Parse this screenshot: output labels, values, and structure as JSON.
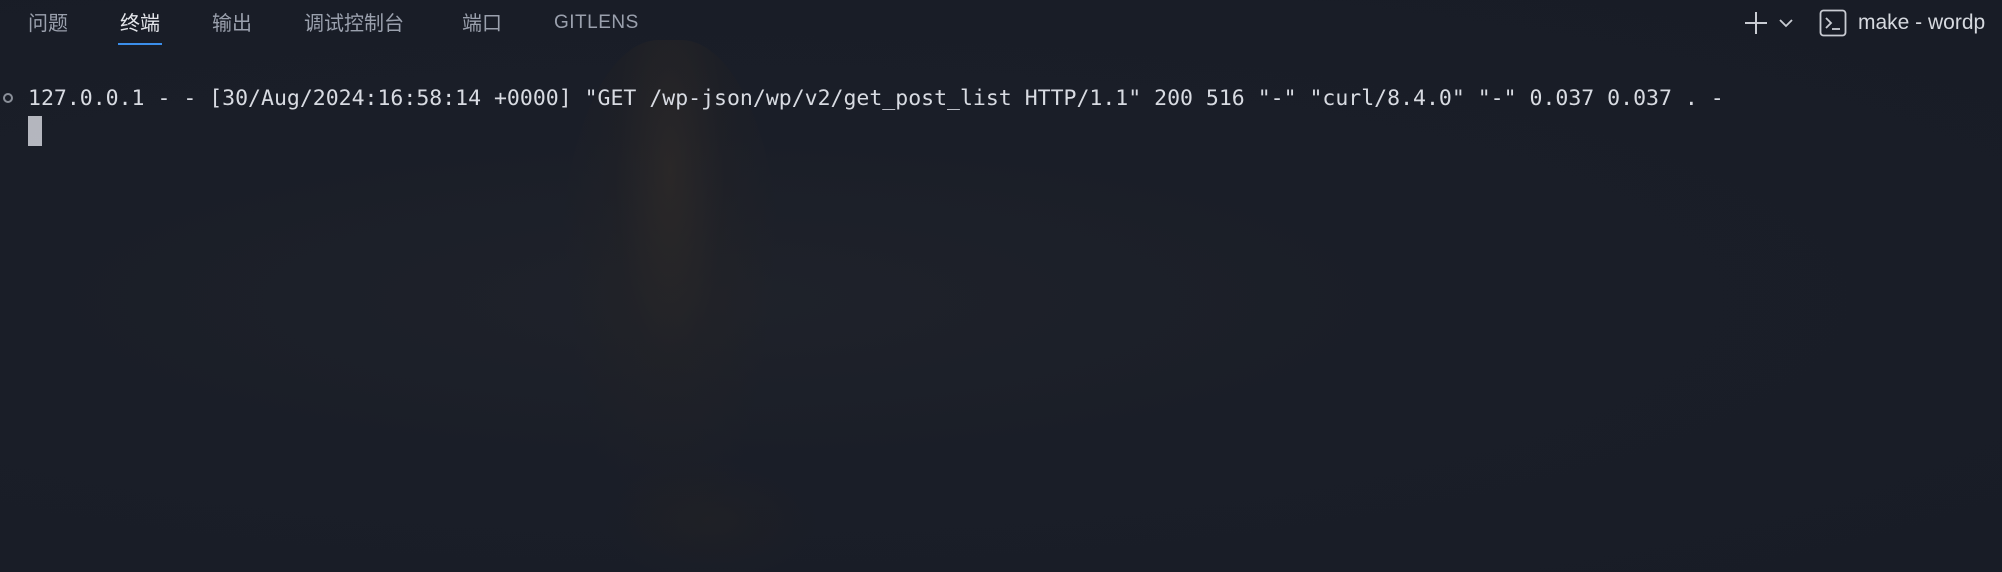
{
  "tabs": [
    {
      "label": "问题",
      "active": false
    },
    {
      "label": "终端",
      "active": true
    },
    {
      "label": "输出",
      "active": false
    },
    {
      "label": "调试控制台",
      "active": false
    },
    {
      "label": "端口",
      "active": false
    },
    {
      "label": "GITLENS",
      "active": false
    }
  ],
  "toolbar": {
    "new_terminal_icon": "plus-icon",
    "dropdown_icon": "chevron-down-icon",
    "terminal_icon": "terminal-prompt-icon",
    "terminal_name": "make - wordp"
  },
  "terminal": {
    "lines": [
      "127.0.0.1 - - [30/Aug/2024:16:58:14 +0000] \"GET /wp-json/wp/v2/get_post_list HTTP/1.1\" 200 516 \"-\" \"curl/8.4.0\" \"-\" 0.037 0.037 . -"
    ]
  },
  "colors": {
    "background": "#1a1e28",
    "active_tab_underline": "#3b8eea",
    "text": "#d8dbe2",
    "inactive_tab": "#9aa0ad"
  }
}
